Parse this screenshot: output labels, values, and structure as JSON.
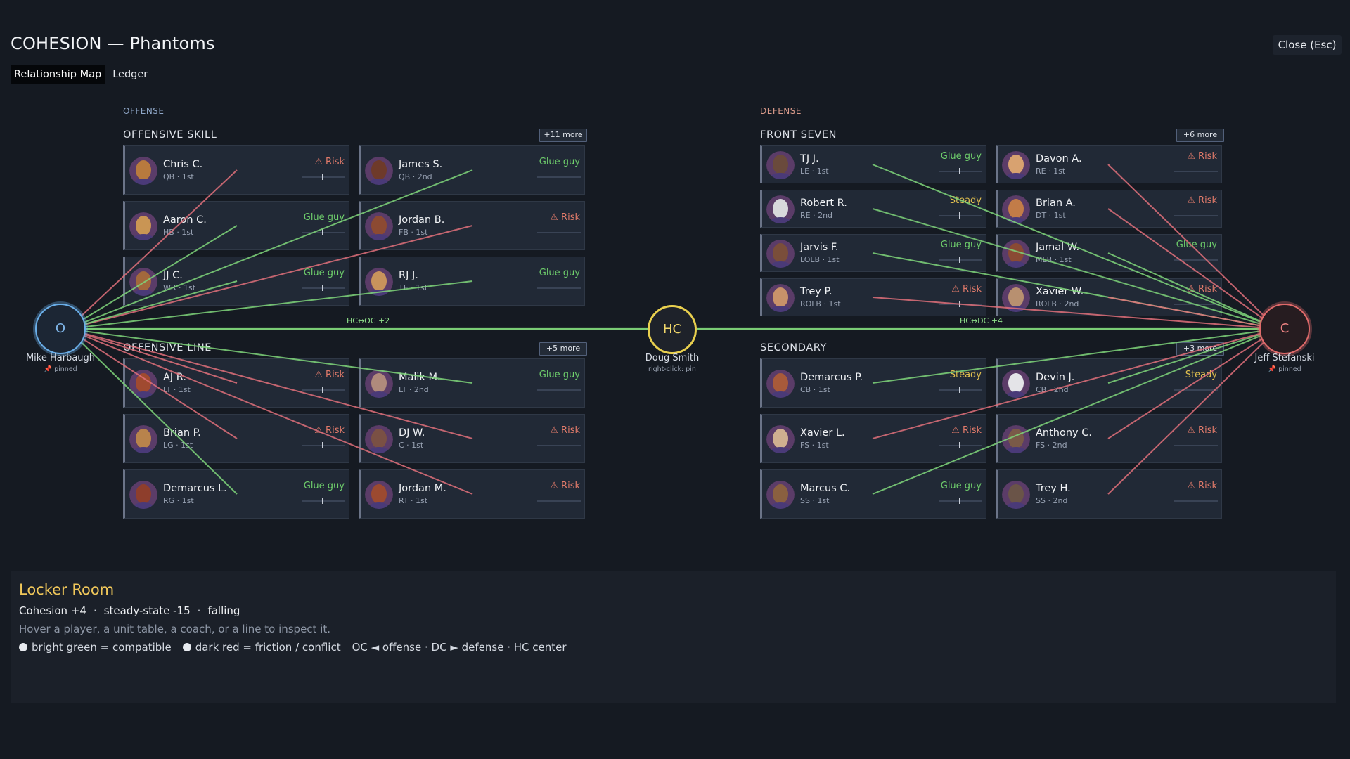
{
  "header": {
    "title": "COHESION — Phantoms",
    "close_label": "Close (Esc)"
  },
  "tabs": [
    {
      "label": "Relationship Map",
      "active": true
    },
    {
      "label": "Ledger",
      "active": false
    }
  ],
  "sections": {
    "offense": "OFFENSE",
    "defense": "DEFENSE"
  },
  "groups": {
    "offensive_skill": {
      "title": "OFFENSIVE SKILL",
      "more": "+11 more"
    },
    "offensive_line": {
      "title": "OFFENSIVE LINE",
      "more": "+5 more"
    },
    "front_seven": {
      "title": "FRONT SEVEN",
      "more": "+6 more"
    },
    "secondary": {
      "title": "SECONDARY",
      "more": "+3 more"
    }
  },
  "players": [
    {
      "name": "Chris C.",
      "sub": "QB · 1st",
      "tag": "⚠ Risk",
      "status": "risk",
      "skin": "#b87a3e"
    },
    {
      "name": "James S.",
      "sub": "QB · 2nd",
      "tag": "Glue guy",
      "status": "glue",
      "skin": "#6e3a2a"
    },
    {
      "name": "Aaron C.",
      "sub": "HB · 1st",
      "tag": "Glue guy",
      "status": "glue",
      "skin": "#c99554"
    },
    {
      "name": "Jordan B.",
      "sub": "FB · 1st",
      "tag": "⚠ Risk",
      "status": "risk",
      "skin": "#8c4a32"
    },
    {
      "name": "JJ C.",
      "sub": "WR · 1st",
      "tag": "Glue guy",
      "status": "glue",
      "skin": "#a2683c"
    },
    {
      "name": "RJ J.",
      "sub": "TE · 1st",
      "tag": "Glue guy",
      "status": "glue",
      "skin": "#c8935c"
    },
    {
      "name": "AJ R.",
      "sub": "LT · 1st",
      "tag": "⚠ Risk",
      "status": "risk",
      "skin": "#a04a30"
    },
    {
      "name": "Malik M.",
      "sub": "LT · 2nd",
      "tag": "Glue guy",
      "status": "glue",
      "skin": "#b08a7c"
    },
    {
      "name": "Brian P.",
      "sub": "LG · 1st",
      "tag": "⚠ Risk",
      "status": "risk",
      "skin": "#b8834c"
    },
    {
      "name": "DJ W.",
      "sub": "C · 1st",
      "tag": "⚠ Risk",
      "status": "risk",
      "skin": "#7a5044"
    },
    {
      "name": "Demarcus L.",
      "sub": "RG · 1st",
      "tag": "Glue guy",
      "status": "glue",
      "skin": "#8e3e2c"
    },
    {
      "name": "Jordan M.",
      "sub": "RT · 1st",
      "tag": "⚠ Risk",
      "status": "risk",
      "skin": "#9c4a30"
    },
    {
      "name": "TJ J.",
      "sub": "LE · 1st",
      "tag": "Glue guy",
      "status": "glue",
      "skin": "#6a4a3c"
    },
    {
      "name": "Davon A.",
      "sub": "RE · 1st",
      "tag": "⚠ Risk",
      "status": "risk",
      "skin": "#d8a270"
    },
    {
      "name": "Robert R.",
      "sub": "RE · 2nd",
      "tag": "Steady",
      "status": "steady",
      "skin": "#d8d8dc"
    },
    {
      "name": "Brian A.",
      "sub": "DT · 1st",
      "tag": "⚠ Risk",
      "status": "risk",
      "skin": "#c27c48"
    },
    {
      "name": "Jarvis F.",
      "sub": "LOLB · 1st",
      "tag": "Glue guy",
      "status": "glue",
      "skin": "#7a4e3a"
    },
    {
      "name": "Jamal W.",
      "sub": "MLB · 1st",
      "tag": "Glue guy",
      "status": "glue",
      "skin": "#8a4a34"
    },
    {
      "name": "Trey P.",
      "sub": "ROLB · 1st",
      "tag": "⚠ Risk",
      "status": "risk",
      "skin": "#c8926a"
    },
    {
      "name": "Xavier W.",
      "sub": "ROLB · 2nd",
      "tag": "⚠ Risk",
      "status": "risk",
      "skin": "#b89070"
    },
    {
      "name": "Demarcus P.",
      "sub": "CB · 1st",
      "tag": "Steady",
      "status": "steady",
      "skin": "#a85a3a"
    },
    {
      "name": "Devin J.",
      "sub": "CB · 2nd",
      "tag": "Steady",
      "status": "steady",
      "skin": "#e4e4e8"
    },
    {
      "name": "Xavier L.",
      "sub": "FS · 1st",
      "tag": "⚠ Risk",
      "status": "risk",
      "skin": "#d0b090"
    },
    {
      "name": "Anthony C.",
      "sub": "FS · 2nd",
      "tag": "⚠ Risk",
      "status": "risk",
      "skin": "#7a5a48"
    },
    {
      "name": "Marcus C.",
      "sub": "SS · 1st",
      "tag": "Glue guy",
      "status": "glue",
      "skin": "#8a6040"
    },
    {
      "name": "Trey H.",
      "sub": "SS · 2nd",
      "tag": "⚠ Risk",
      "status": "risk",
      "skin": "#6a5448"
    }
  ],
  "coaches": {
    "oc": {
      "initial": "O",
      "name": "Mike Harbaugh",
      "sub": "📌 pinned"
    },
    "hc": {
      "initial": "HC",
      "name": "Doug Smith",
      "sub": "right-click: pin"
    },
    "dc": {
      "initial": "C",
      "name": "Jeff Stefanski",
      "sub": "📌 pinned"
    }
  },
  "edges": {
    "hc_oc": "HC↔OC +2",
    "hc_dc": "HC↔DC +4"
  },
  "colors": {
    "compatible": "#7fd67a",
    "friction": "#e0707a",
    "oc_ring": "#6aaee8",
    "hc_ring": "#e8cf4e",
    "dc_ring": "#e06a6a"
  },
  "panel": {
    "title": "Locker Room",
    "cohesion": "Cohesion +4",
    "sep": "·",
    "steady_state": "steady-state -15",
    "trend": "falling",
    "hint": "Hover a player, a unit table, a coach, or a line to inspect it.",
    "legend_green": "bright green = compatible",
    "legend_red": "dark red = friction / conflict",
    "legend_keys": "OC ◄ offense · DC ► defense · HC center"
  }
}
